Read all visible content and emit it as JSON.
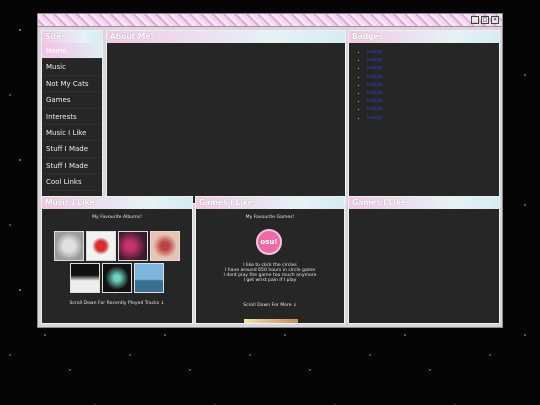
{
  "window": {
    "controls": [
      "_",
      "□",
      "×"
    ]
  },
  "sidebar": {
    "title": "Sites",
    "items": [
      "Home",
      "Music",
      "Not My Cats",
      "Games",
      "Interests",
      "Music I Like",
      "Stuff I Made",
      "Stuff I Made",
      "Cool Links"
    ]
  },
  "about": {
    "title": "About Me!"
  },
  "badges": {
    "title": "Badges",
    "items": [
      "badge",
      "badge",
      "badge",
      "badge",
      "badge",
      "badge",
      "badge",
      "badge",
      "badge"
    ]
  },
  "music": {
    "title": "Music I Like",
    "heading": "My Favourite Albums!",
    "footer": "Scroll Down For Recently Played Tracks ↓"
  },
  "games": {
    "title": "Games I Like",
    "heading": "My Favourite Games!",
    "logo_text": "osu!",
    "lines": [
      "I like to click the circles",
      "I have around 650 hours in circle game",
      "I dont play the game too much anymore",
      "I get wrist pain if I play"
    ],
    "footer": "Scroll Down For More ↓"
  },
  "extra": {
    "title": "Games I Like"
  },
  "colors": {
    "accent_pink": "#f2c3e5",
    "panel_bg": "#262626",
    "link_blue": "#2a3fb0"
  }
}
